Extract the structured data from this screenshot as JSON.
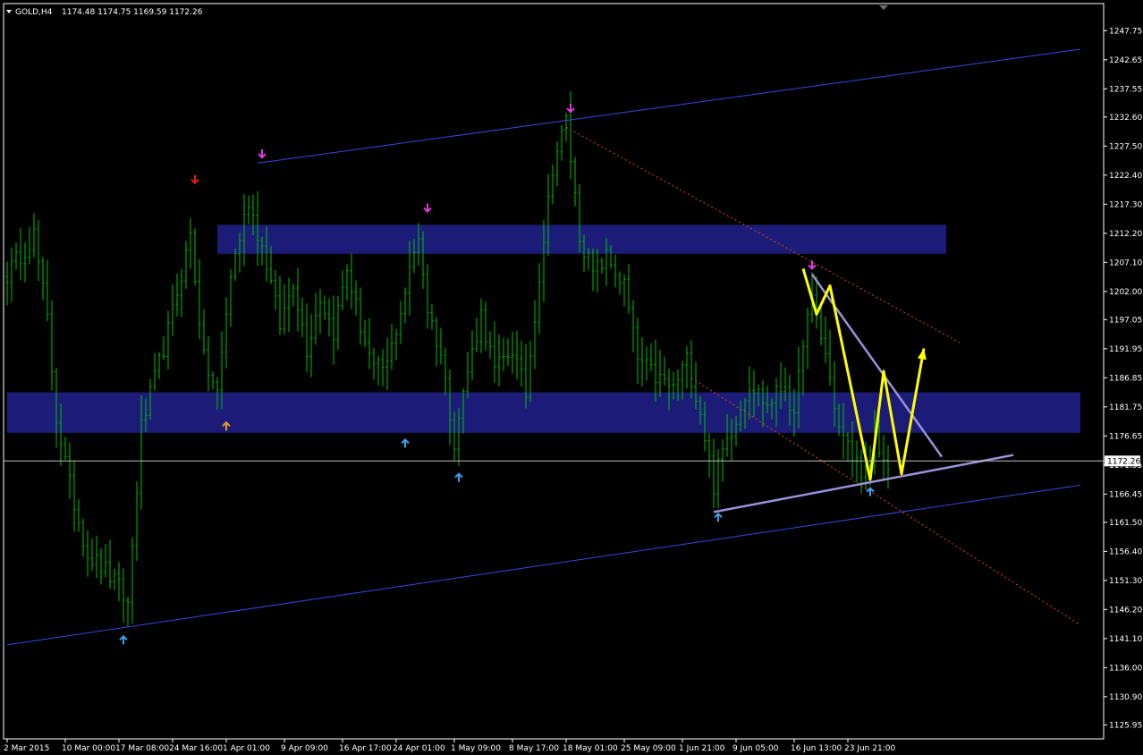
{
  "header": {
    "symbol": "GOLD,H4",
    "ohlc": "1174.48 1174.75 1169.59 1172.26"
  },
  "colors": {
    "background": "#000000",
    "candle": "#00c000",
    "zone": "#1c1c78",
    "channel": "#3a46e0",
    "dotted": "#e04a10",
    "triangle": "#9a92d8",
    "projection": "#ffff00",
    "bid_line": "#c0c0c0",
    "axis": "#ffffff",
    "arrow_magenta": "#e23ae2",
    "arrow_red": "#e81a10",
    "arrow_orange": "#e89a20",
    "arrow_blue": "#3aa0f0"
  },
  "chart_data": {
    "type": "candlestick",
    "symbol": "GOLD",
    "timeframe": "H4",
    "ylim": [
      1123.5,
      1252.5
    ],
    "bars": 248,
    "y_ticks": [
      "1247.75",
      "1242.65",
      "1237.55",
      "1232.60",
      "1227.50",
      "1222.40",
      "1217.30",
      "1212.20",
      "1207.10",
      "1202.00",
      "1197.05",
      "1191.95",
      "1186.85",
      "1181.75",
      "1176.65",
      "1171.55",
      "1166.45",
      "1161.50",
      "1156.40",
      "1151.30",
      "1146.20",
      "1141.10",
      "1136.00",
      "1130.90",
      "1125.95"
    ],
    "x_ticks": [
      {
        "label": "2 Mar 2015",
        "bar": 0
      },
      {
        "label": "10 Mar 00:00",
        "bar": 13
      },
      {
        "label": "17 Mar 08:00",
        "bar": 25
      },
      {
        "label": "24 Mar 16:00",
        "bar": 37
      },
      {
        "label": "1 Apr 01:00",
        "bar": 49
      },
      {
        "label": "9 Apr 09:00",
        "bar": 62
      },
      {
        "label": "16 Apr 17:00",
        "bar": 75
      },
      {
        "label": "24 Apr 01:00",
        "bar": 87
      },
      {
        "label": "1 May 09:00",
        "bar": 100
      },
      {
        "label": "8 May 17:00",
        "bar": 113
      },
      {
        "label": "18 May 01:00",
        "bar": 125
      },
      {
        "label": "25 May 09:00",
        "bar": 138
      },
      {
        "label": "1 Jun 21:00",
        "bar": 151
      },
      {
        "label": "9 Jun 05:00",
        "bar": 163
      },
      {
        "label": "16 Jun 13:00",
        "bar": 176
      },
      {
        "label": "23 Jun 21:00",
        "bar": 188
      }
    ],
    "current_price": "1172.26",
    "anchors": [
      [
        0,
        1205
      ],
      [
        6,
        1212
      ],
      [
        9,
        1197
      ],
      [
        11,
        1180
      ],
      [
        14,
        1168
      ],
      [
        18,
        1156
      ],
      [
        22,
        1153
      ],
      [
        25,
        1150
      ],
      [
        27,
        1147
      ],
      [
        30,
        1178
      ],
      [
        36,
        1195
      ],
      [
        41,
        1212
      ],
      [
        44,
        1190
      ],
      [
        47,
        1184
      ],
      [
        50,
        1205
      ],
      [
        54,
        1218
      ],
      [
        58,
        1207
      ],
      [
        61,
        1196
      ],
      [
        64,
        1204
      ],
      [
        67,
        1192
      ],
      [
        70,
        1201
      ],
      [
        73,
        1195
      ],
      [
        76,
        1206
      ],
      [
        79,
        1196
      ],
      [
        82,
        1188
      ],
      [
        85,
        1189
      ],
      [
        89,
        1202
      ],
      [
        92,
        1212
      ],
      [
        94,
        1199
      ],
      [
        97,
        1191
      ],
      [
        100,
        1176
      ],
      [
        103,
        1188
      ],
      [
        106,
        1198
      ],
      [
        109,
        1188
      ],
      [
        113,
        1192
      ],
      [
        116,
        1184
      ],
      [
        119,
        1205
      ],
      [
        122,
        1224
      ],
      [
        125,
        1232
      ],
      [
        128,
        1212
      ],
      [
        131,
        1205
      ],
      [
        134,
        1208
      ],
      [
        138,
        1203
      ],
      [
        141,
        1190
      ],
      [
        145,
        1187
      ],
      [
        149,
        1185
      ],
      [
        152,
        1190
      ],
      [
        155,
        1181
      ],
      [
        158,
        1168
      ],
      [
        160,
        1174
      ],
      [
        163,
        1180
      ],
      [
        166,
        1186
      ],
      [
        170,
        1182
      ],
      [
        174,
        1186
      ],
      [
        176,
        1179
      ],
      [
        178,
        1194
      ],
      [
        180,
        1200
      ],
      [
        183,
        1191
      ],
      [
        186,
        1178
      ],
      [
        189,
        1173
      ],
      [
        192,
        1170
      ],
      [
        194,
        1176
      ],
      [
        196,
        1172
      ],
      [
        197,
        1172
      ]
    ],
    "zones": [
      {
        "bar_from": 47,
        "bar_to": 210,
        "price_from": 1208.6,
        "price_to": 1213.7
      },
      {
        "bar_from": 0,
        "bar_to": 240,
        "price_from": 1177.2,
        "price_to": 1184.3
      }
    ],
    "lines": [
      {
        "kind": "channel",
        "points": [
          [
            56,
            1224.5
          ],
          [
            240,
            1244.5
          ]
        ]
      },
      {
        "kind": "channel",
        "points": [
          [
            0,
            1140.0
          ],
          [
            240,
            1168.0
          ]
        ]
      },
      {
        "kind": "dotted",
        "points": [
          [
            125,
            1230.8
          ],
          [
            213,
            1193.0
          ]
        ]
      },
      {
        "kind": "dotted",
        "points": [
          [
            153,
            1186.8
          ],
          [
            240,
            1143.5
          ]
        ]
      },
      {
        "kind": "triangle",
        "points": [
          [
            158,
            1163.3
          ],
          [
            225,
            1173.3
          ]
        ]
      },
      {
        "kind": "triangle",
        "points": [
          [
            180,
            1205.0
          ],
          [
            209,
            1173.0
          ]
        ]
      },
      {
        "kind": "projection",
        "points": [
          [
            178,
            1206.0
          ],
          [
            181,
            1198.0
          ],
          [
            184,
            1203.0
          ],
          [
            193,
            1169.0
          ],
          [
            196,
            1188.0
          ],
          [
            200,
            1170.0
          ],
          [
            205,
            1192.0
          ]
        ]
      }
    ],
    "signals": [
      {
        "bar": 57,
        "price": 1225.5,
        "dir": "down",
        "color": "magenta"
      },
      {
        "bar": 42,
        "price": 1221.0,
        "dir": "down",
        "color": "red"
      },
      {
        "bar": 94,
        "price": 1216.0,
        "dir": "down",
        "color": "magenta"
      },
      {
        "bar": 126,
        "price": 1233.5,
        "dir": "down",
        "color": "magenta"
      },
      {
        "bar": 180,
        "price": 1206.0,
        "dir": "down",
        "color": "magenta"
      },
      {
        "bar": 49,
        "price": 1179.0,
        "dir": "up",
        "color": "orange"
      },
      {
        "bar": 89,
        "price": 1176.0,
        "dir": "up",
        "color": "blue"
      },
      {
        "bar": 101,
        "price": 1170.0,
        "dir": "up",
        "color": "blue"
      },
      {
        "bar": 26,
        "price": 1141.5,
        "dir": "up",
        "color": "blue"
      },
      {
        "bar": 159,
        "price": 1163.0,
        "dir": "up",
        "color": "blue"
      },
      {
        "bar": 193,
        "price": 1167.5,
        "dir": "up",
        "color": "blue"
      }
    ]
  }
}
